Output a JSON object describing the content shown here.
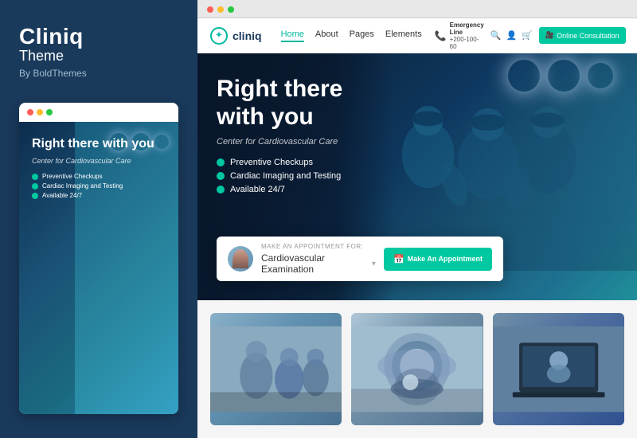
{
  "sidebar": {
    "brand_name": "Cliniq",
    "brand_sub": "Theme",
    "brand_by": "By BoldThemes",
    "preview": {
      "hero_title": "Right there with you",
      "hero_subtitle": "Center for Cardiovascular Care",
      "features": [
        {
          "text": "Preventive Checkups"
        },
        {
          "text": "Cardiac Imaging and Testing"
        },
        {
          "text": "Available 24/7"
        }
      ]
    }
  },
  "browser": {
    "dots": [
      "red",
      "yellow",
      "green"
    ]
  },
  "nav": {
    "logo_text": "cliniq",
    "links": [
      {
        "label": "Home",
        "active": true
      },
      {
        "label": "About"
      },
      {
        "label": "Pages"
      },
      {
        "label": "Elements"
      }
    ],
    "emergency_label": "Emergency Line",
    "emergency_number": "+200-100-60",
    "online_consult": "Online Consultation"
  },
  "hero": {
    "title_line1": "Right there",
    "title_line2": "with you",
    "subtitle": "Center for Cardiovascular Care",
    "features": [
      {
        "text": "Preventive Checkups"
      },
      {
        "text": "Cardiac Imaging and Testing"
      },
      {
        "text": "Available 24/7"
      }
    ]
  },
  "appointment": {
    "label": "Make An Appointment For:",
    "option": "Cardiovascular Examination",
    "button_label": "Make An Appointment"
  }
}
